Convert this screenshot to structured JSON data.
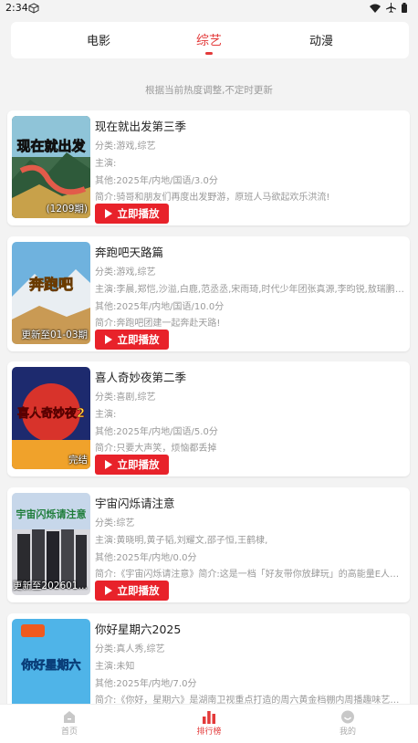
{
  "status": {
    "time": "2:34"
  },
  "tabs": [
    {
      "label": "电影",
      "active": false
    },
    {
      "label": "综艺",
      "active": true
    },
    {
      "label": "动漫",
      "active": false
    }
  ],
  "notice": "根据当前热度调整,不定时更新",
  "play_label": "立即播放",
  "items": [
    {
      "title": "现在就出发第三季",
      "category": "分类:游戏,综艺",
      "cast": "主演:",
      "other": "其他:2025年/内地/国语/3.0分",
      "intro": "简介:骑哥和朋友们再度出发野游，原班人马欲起欢乐洪流!",
      "badge": "(1209期)",
      "poster_text": "现在就出发"
    },
    {
      "title": "奔跑吧天路篇",
      "category": "分类:游戏,综艺",
      "cast": "主演:李晨,郑恺,沙溢,白鹿,范丞丞,宋雨琦,时代少年团张真源,李昀锐,敖瑞鹏,翟…",
      "other": "其他:2025年/内地/国语/10.0分",
      "intro": "简介:奔跑吧团建一起奔赴天路!",
      "badge": "更新至01-03期",
      "poster_text": "奔跑吧"
    },
    {
      "title": "喜人奇妙夜第二季",
      "category": "分类:喜剧,综艺",
      "cast": "主演:",
      "other": "其他:2025年/内地/国语/5.0分",
      "intro": "简介:只要大声笑，烦恼都丢掉",
      "badge": "完结",
      "poster_text": "喜人奇妙夜2"
    },
    {
      "title": "宇宙闪烁请注意",
      "category": "分类:综艺",
      "cast": "主演:黄晓明,黄子韬,刘耀文,邵子恒,王鹤棣,",
      "other": "其他:2025年/内地/0.0分",
      "intro": "简介:《宇宙闪烁请注意》简介:这是一档「好友带你放肆玩」的高能量E人局…",
      "badge": "更新至202601…",
      "poster_text": "宇宙闪烁请注意"
    },
    {
      "title": "你好星期六2025",
      "category": "分类:真人秀,综艺",
      "cast": "主演:未知",
      "other": "其他:2025年/内地/7.0分",
      "intro": "简介:《你好，星期六》是湖南卫视重点打造的周六黄金档棚内周播趣味艺能…",
      "badge": "",
      "poster_text": "你好星期六"
    }
  ],
  "bottom_nav": [
    {
      "label": "首页",
      "icon": "home-icon",
      "active": false
    },
    {
      "label": "排行榜",
      "icon": "ranking-icon",
      "active": true
    },
    {
      "label": "我的",
      "icon": "profile-icon",
      "active": false
    }
  ],
  "colors": {
    "accent": "#e33a3a",
    "play_button": "#e8222a"
  }
}
